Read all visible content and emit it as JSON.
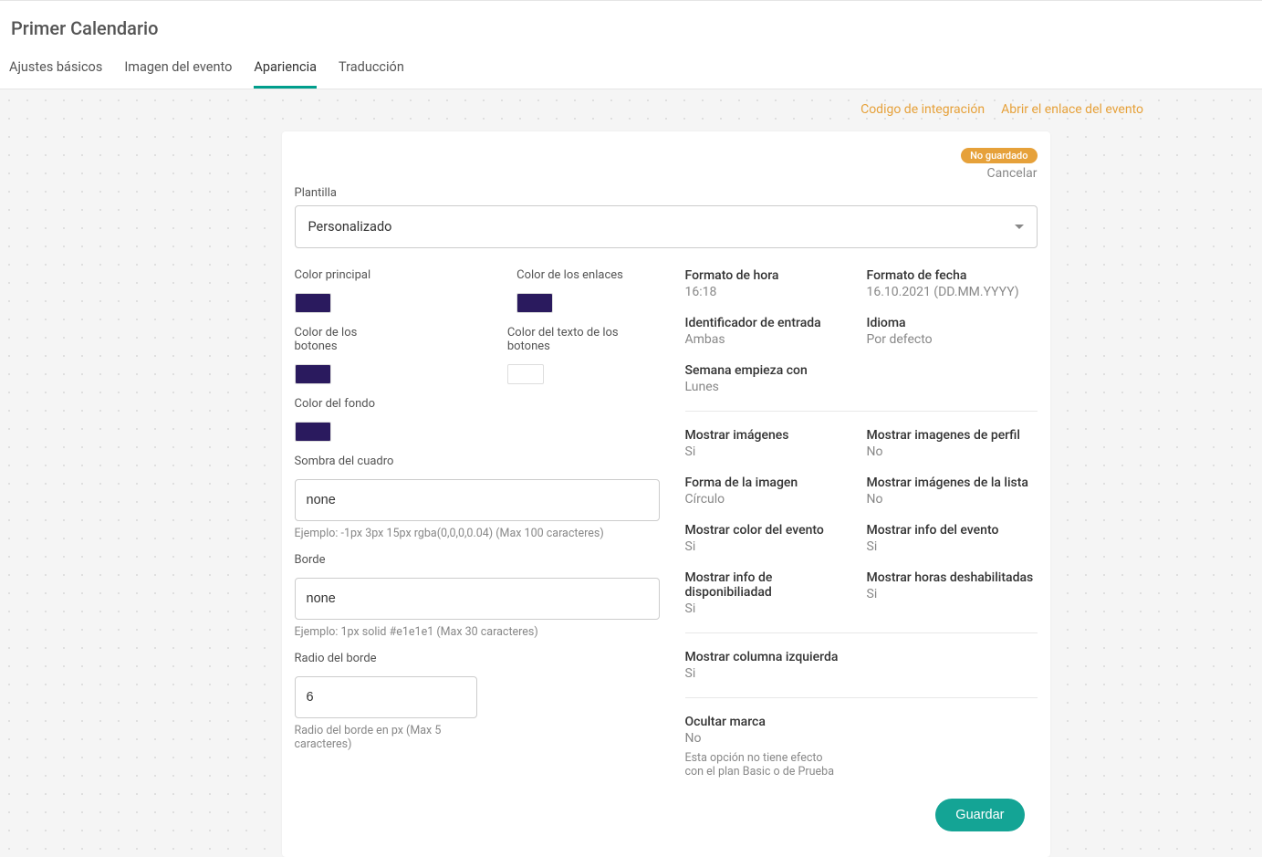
{
  "header": {
    "title": "Primer Calendario",
    "tabs": [
      {
        "label": "Ajustes básicos",
        "active": false
      },
      {
        "label": "Imagen del evento",
        "active": false
      },
      {
        "label": "Apariencia",
        "active": true
      },
      {
        "label": "Traducción",
        "active": false
      }
    ]
  },
  "toplinks": {
    "integration": "Codigo de integración",
    "open_event": "Abrir el enlace del evento"
  },
  "status": {
    "badge": "No guardado",
    "cancel": "Cancelar"
  },
  "template": {
    "label": "Plantilla",
    "value": "Personalizado"
  },
  "colors": {
    "main_label": "Color principal",
    "main_value": "#2a1a5e",
    "links_label": "Color de los enlaces",
    "links_value": "#2a1a5e",
    "buttons_label": "Color de los botones",
    "buttons_value": "#2a1a5e",
    "button_text_label": "Color del texto de los botones",
    "button_text_value": "#ffffff",
    "background_label": "Color del fondo",
    "background_value": "#2a1a5e"
  },
  "box_shadow": {
    "label": "Sombra del cuadro",
    "value": "none",
    "hint": "Ejemplo: -1px 3px 15px rgba(0,0,0,0.04) (Max 100 caracteres)"
  },
  "border": {
    "label": "Borde",
    "value": "none",
    "hint": "Ejemplo: 1px solid #e1e1e1 (Max 30 caracteres)"
  },
  "border_radius": {
    "label": "Radio del borde",
    "value": "6",
    "hint": "Radio del borde en px (Max 5 caracteres)"
  },
  "right": {
    "time_format": {
      "k": "Formato de hora",
      "v": "16:18"
    },
    "date_format": {
      "k": "Formato de fecha",
      "v": "16.10.2021 (DD.MM.YYYY)"
    },
    "entry_id": {
      "k": "Identificador de entrada",
      "v": "Ambas"
    },
    "language": {
      "k": "Idioma",
      "v": "Por defecto"
    },
    "week_start": {
      "k": "Semana empieza con",
      "v": "Lunes"
    },
    "show_images": {
      "k": "Mostrar imágenes",
      "v": "Si"
    },
    "show_profile": {
      "k": "Mostrar imagenes de perfil",
      "v": "No"
    },
    "image_shape": {
      "k": "Forma de la imagen",
      "v": "Círculo"
    },
    "show_list_images": {
      "k": "Mostrar imágenes de la lista",
      "v": "No"
    },
    "show_event_color": {
      "k": "Mostrar color del evento",
      "v": "Si"
    },
    "show_event_info": {
      "k": "Mostrar info del evento",
      "v": "Si"
    },
    "show_avail": {
      "k": "Mostrar info de disponibiliadad",
      "v": "Si"
    },
    "show_disabled": {
      "k": "Mostrar horas deshabilitadas",
      "v": "Si"
    },
    "show_left_col": {
      "k": "Mostrar columna izquierda",
      "v": "Si"
    },
    "hide_brand": {
      "k": "Ocultar marca",
      "v": "No",
      "hint": "Esta opción no tiene efecto con el plan Basic o de Prueba"
    }
  },
  "save_label": "Guardar"
}
